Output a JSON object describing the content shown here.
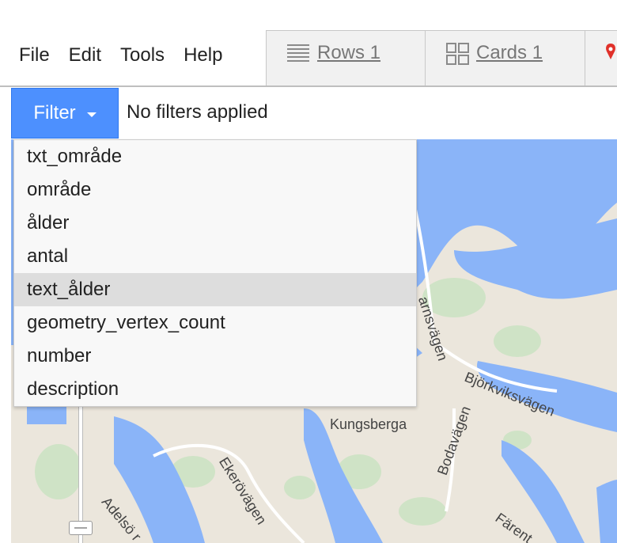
{
  "menu": [
    "File",
    "Edit",
    "Tools",
    "Help"
  ],
  "tabs": [
    {
      "label": "Rows 1",
      "icon": "rows-icon"
    },
    {
      "label": "Cards 1",
      "icon": "cards-icon"
    },
    {
      "label": "",
      "icon": "map-pin-icon"
    }
  ],
  "filter": {
    "button_label": "Filter",
    "status": "No filters applied",
    "options": [
      "txt_område",
      "område",
      "ålder",
      "antal",
      "text_ålder",
      "geometry_vertex_count",
      "number",
      "description"
    ],
    "highlighted_index": 4
  },
  "map": {
    "labels": [
      "Kungsberga",
      "Björkviksvägen",
      "Bodavägen",
      "Ekerövägen",
      "Adelsö r",
      "Färent",
      "arnsvägen"
    ],
    "zoom_out": "—"
  },
  "colors": {
    "accent": "#4d90fe",
    "water": "#8ab4f8",
    "land": "#ebe6dc",
    "park": "#cfe3c6"
  }
}
